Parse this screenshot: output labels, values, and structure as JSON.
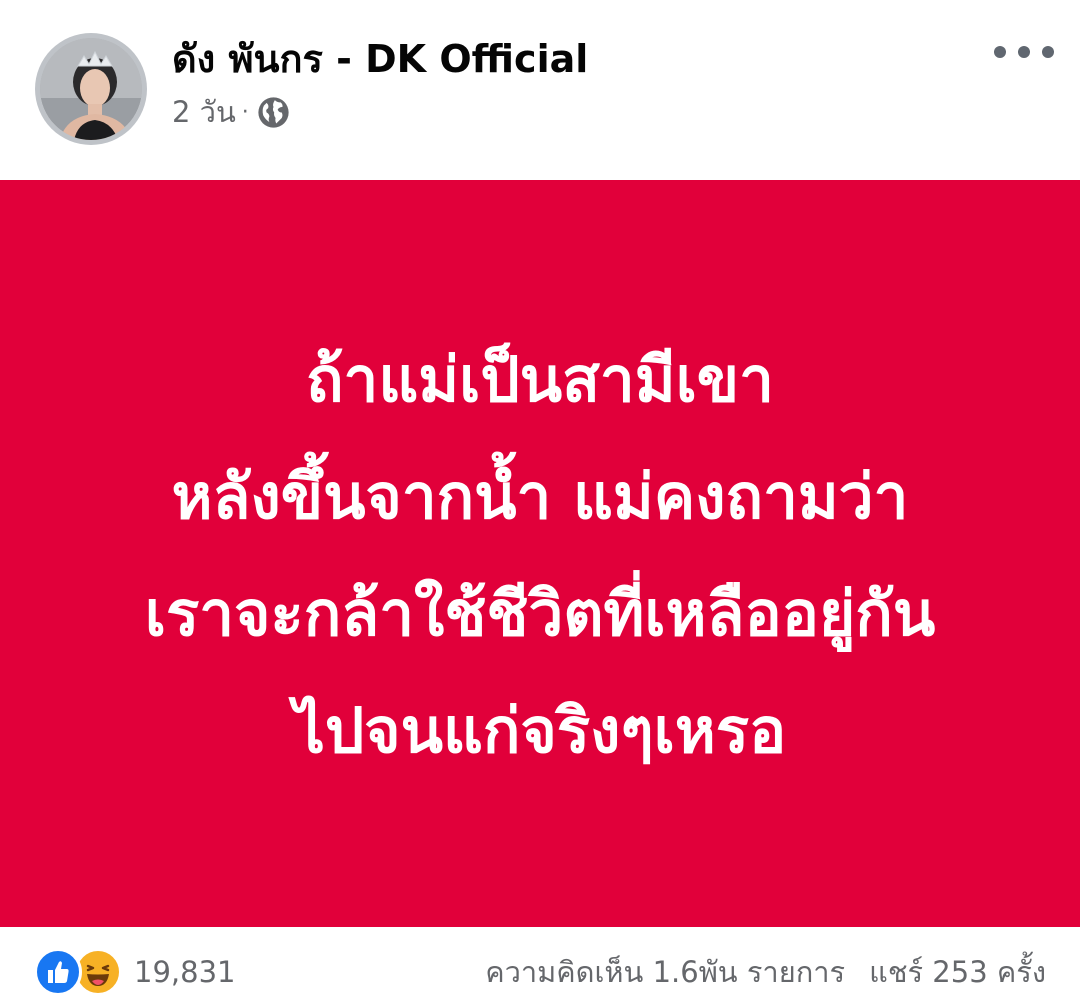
{
  "post": {
    "author_name": "ดัง พันกร - DK Official",
    "timestamp": "2 วัน",
    "separator": "·",
    "privacy_icon": "globe-icon",
    "more_icon": "more-horizontal-icon"
  },
  "card": {
    "background_color": "#e1003a",
    "text_color": "#ffffff",
    "lines": [
      "ถ้าแม่เป็นสามีเขา",
      "หลังขึ้นจากน้ำ แม่คงถามว่า",
      "เราจะกล้าใช้ชีวิตที่เหลืออยู่กัน",
      "ไปจนแก่จริงๆเหรอ"
    ]
  },
  "footer": {
    "reaction_icons": [
      "like-icon",
      "haha-icon"
    ],
    "reaction_count": "19,831",
    "comments_text": "ความคิดเห็น 1.6พัน รายการ",
    "shares_text": "แชร์ 253 ครั้ง"
  },
  "colors": {
    "like_blue": "#1877f2",
    "haha_yellow": "#f7b125",
    "secondary_text": "#65676b"
  }
}
